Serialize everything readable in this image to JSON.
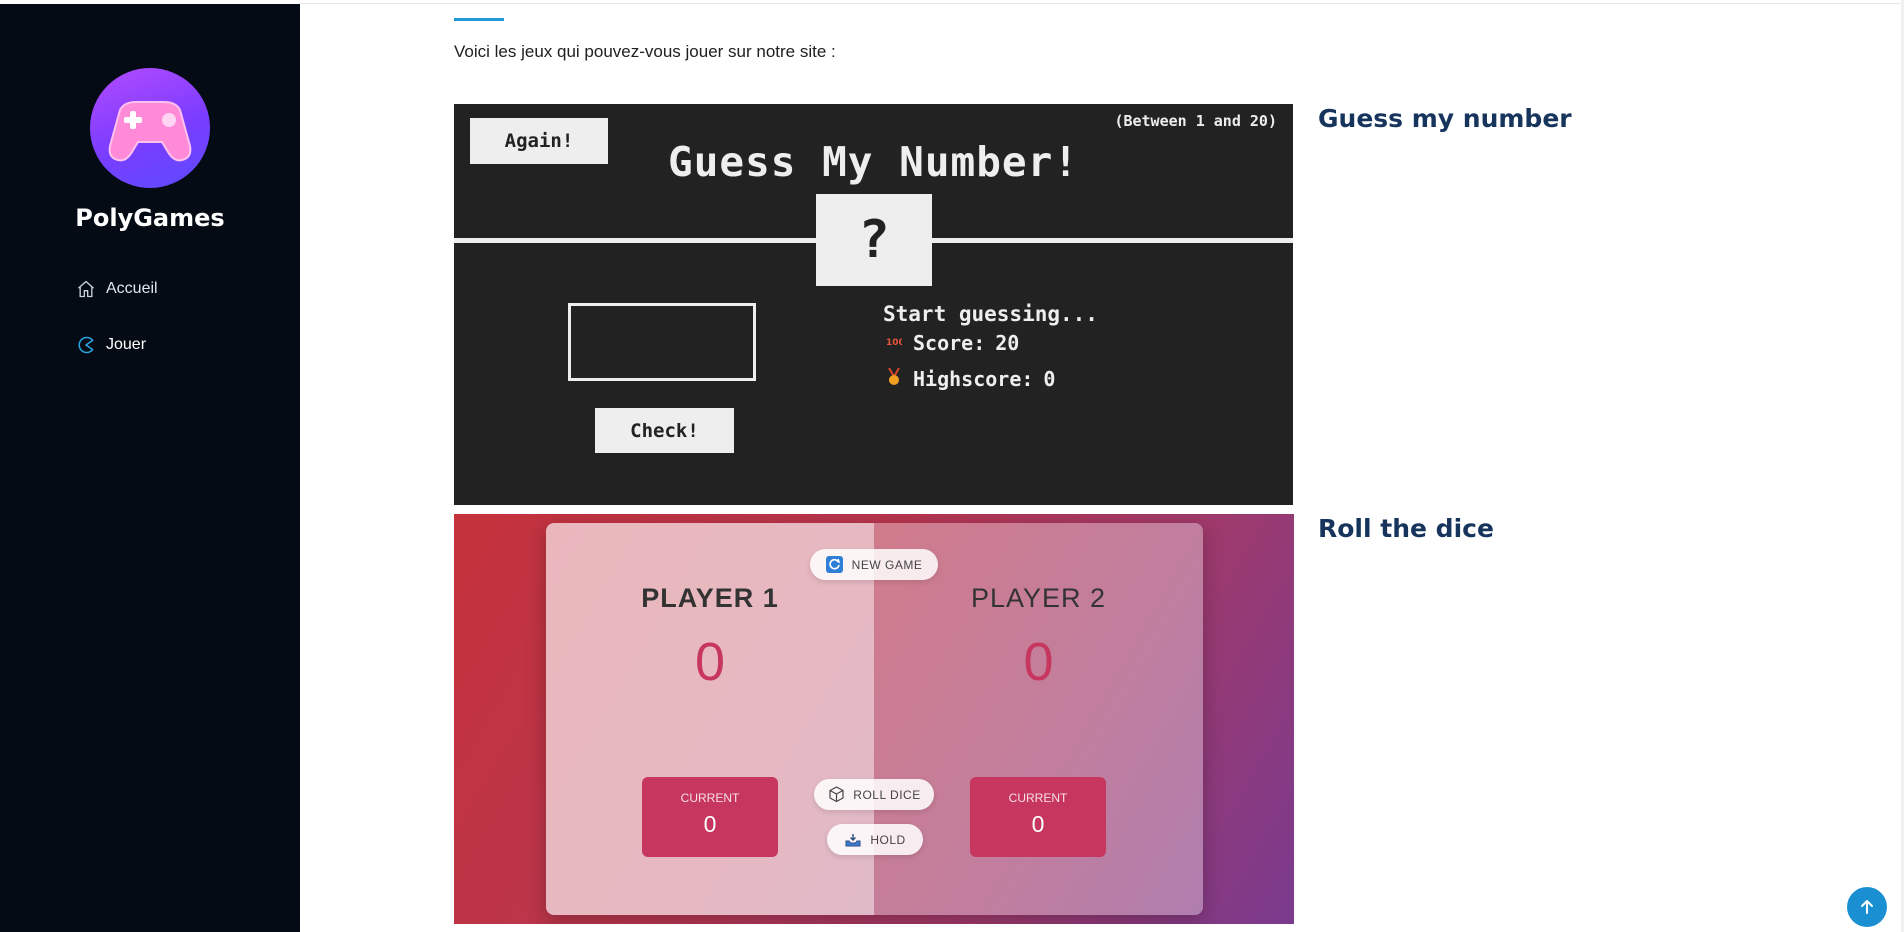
{
  "app": {
    "brand": "PolyGames"
  },
  "sidebar": {
    "items": [
      {
        "label": "Accueil",
        "icon": "home-icon"
      },
      {
        "label": "Jouer",
        "icon": "pacman-icon",
        "active": true
      }
    ],
    "background": "#050b15",
    "accent": "#1f9ad6"
  },
  "main": {
    "intro": "Voici les jeux qui pouvez-vous jouer sur notre site :",
    "games": [
      {
        "title": "Guess my number"
      },
      {
        "title": "Roll the dice"
      }
    ]
  },
  "guess_game": {
    "again_label": "Again!",
    "range_text": "(Between 1 and 20)",
    "title": "Guess My Number!",
    "secret": "?",
    "guess_value": "",
    "check_label": "Check!",
    "message": "Start guessing...",
    "score_label": "Score:",
    "score": "20",
    "highscore_label": "Highscore:",
    "highscore": "0",
    "background": "#222222"
  },
  "dice_game": {
    "new_game_label": "NEW GAME",
    "roll_label": "ROLL DICE",
    "hold_label": "HOLD",
    "players": [
      {
        "name": "PLAYER 1",
        "score": "0",
        "current_label": "CURRENT",
        "current": "0"
      },
      {
        "name": "PLAYER 2",
        "score": "0",
        "current_label": "CURRENT",
        "current": "0"
      }
    ],
    "accent": "#c7365f"
  }
}
